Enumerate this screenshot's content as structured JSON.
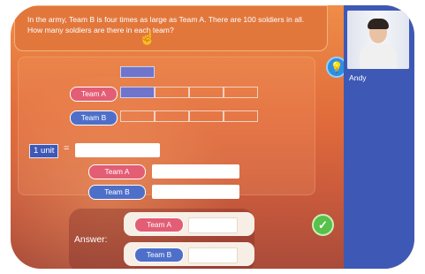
{
  "question": {
    "text": "In the army,  Team B is four times as large as Team A. There are 100 soldiers in all. How many soldiers are there in each team?",
    "hand_icon": "pointer-hand-icon"
  },
  "model": {
    "team_a_label": "Team A",
    "team_b_label": "Team B"
  },
  "unit_equation": {
    "unit_label": "1 unit",
    "equals": "=",
    "team_a_label": "Team A",
    "team_b_label": "Team B"
  },
  "answer": {
    "label": "Answer:",
    "team_a_label": "Team A",
    "team_b_label": "Team B"
  },
  "buttons": {
    "hint_icon": "lightbulb-icon",
    "check_icon": "checkmark-icon"
  },
  "participant": {
    "name": "Andy"
  },
  "colors": {
    "background_orange": "#e06a3b",
    "team_a_pink": "#e35d74",
    "team_b_blue": "#4e6fc9",
    "unit_purple": "#6f75cc",
    "side_panel_blue": "#3e59b5",
    "check_green": "#58c14b"
  }
}
